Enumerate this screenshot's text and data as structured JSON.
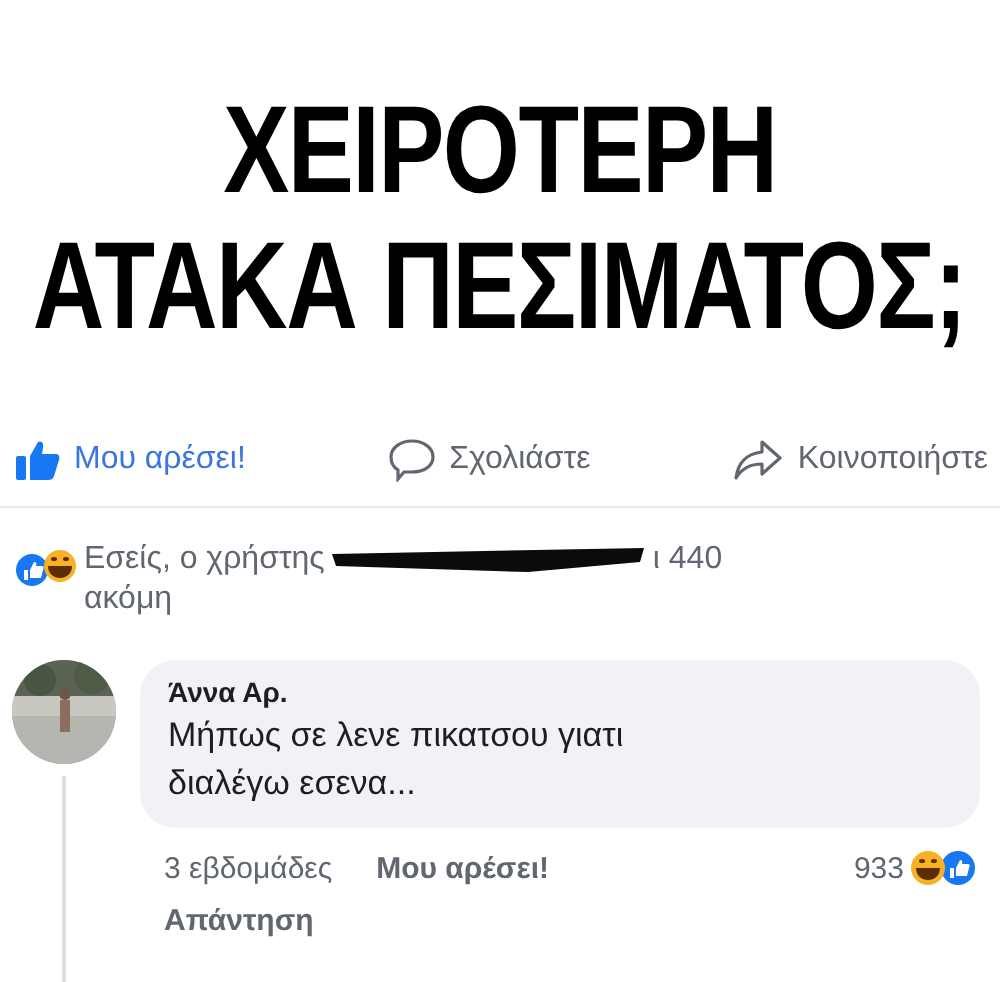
{
  "post": {
    "headline_lines": [
      "ΧΕΙΡΟΤΕΡΗ",
      "ΑΤΑΚΑ ΠΕΣΙΜΑΤΟΣ;"
    ]
  },
  "actions": [
    {
      "kind": "like",
      "label": "Μου αρέσει!",
      "selected": true
    },
    {
      "kind": "comment",
      "label": "Σχολιάστε",
      "selected": false
    },
    {
      "kind": "share",
      "label": "Κοινοποιήστε",
      "selected": false
    }
  ],
  "reactions": {
    "before": "Εσείς, ο χρήστης",
    "after": "ι 440",
    "second_line": "ακόμη"
  },
  "comment": {
    "author": "Άννα Αρ.",
    "text": "Μήπως σε λενε πικατσου γιατι διαλέγω εσενα...",
    "time": "3 εβδομάδες",
    "like_label": "Μου αρέσει!",
    "reply_label": "Απάντηση",
    "reaction_count": "933"
  }
}
